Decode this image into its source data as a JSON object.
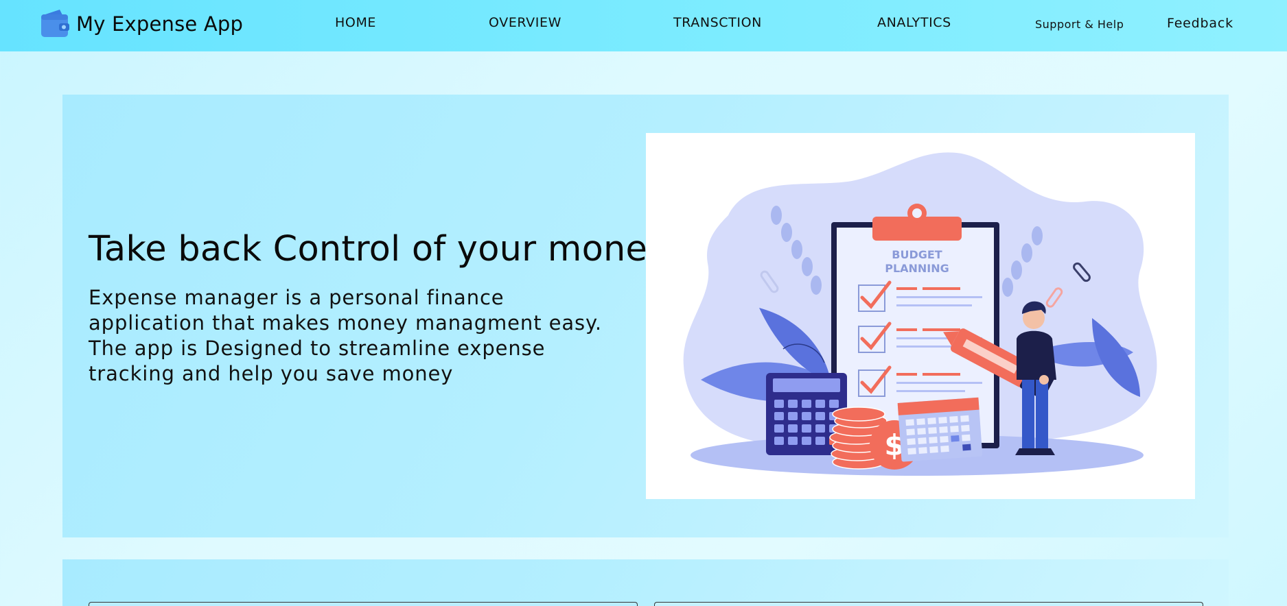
{
  "app": {
    "title": "My Expense App",
    "logo_icon": "wallet-icon"
  },
  "nav": {
    "home": "HOME",
    "overview": "OVERVIEW",
    "transaction": "TRANSCTION",
    "analytics": "ANALYTICS",
    "support": "Support & Help",
    "feedback": "Feedback"
  },
  "hero": {
    "title": "Take back Control of your money",
    "description": "Expense manager is a personal finance application that makes money managment easy. The app is Designed to streamline expense tracking and help you save money",
    "image": {
      "icon": "budget-planning-illustration",
      "clipboard_text_line1": "BUDGET",
      "clipboard_text_line2": "PLANNING"
    }
  },
  "colors": {
    "navbar": "#6fe6ff",
    "page_background": "#dffaff",
    "hero_background": "#b4efff",
    "accent_red": "#f26d5b",
    "accent_blue": "#3d4db7"
  }
}
